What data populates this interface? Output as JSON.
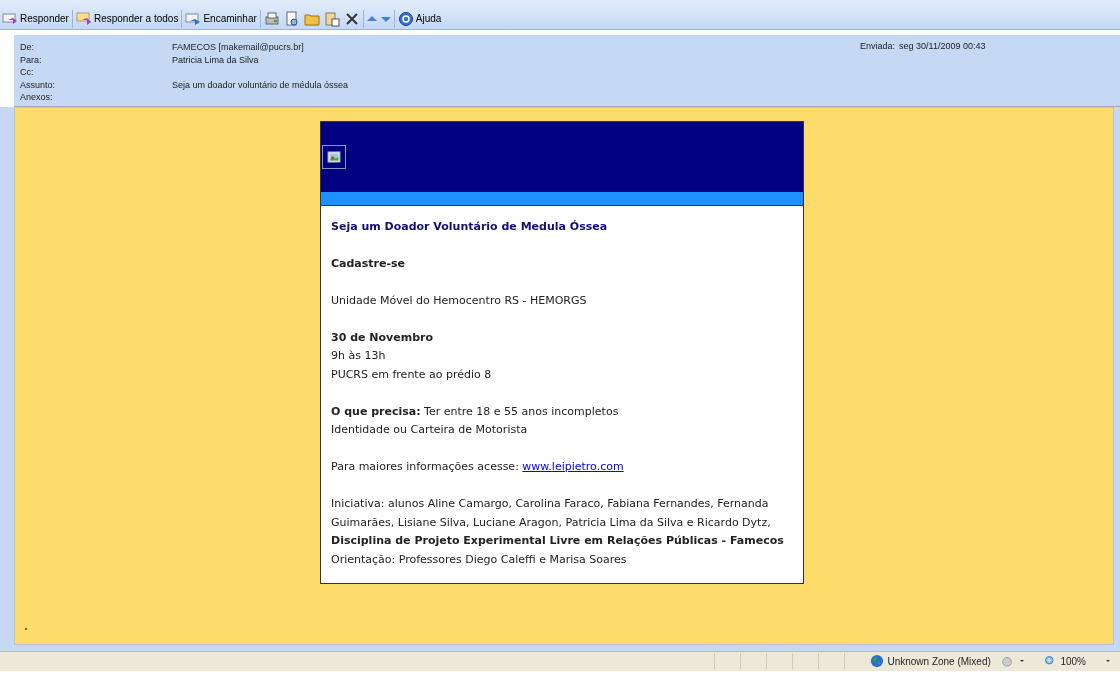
{
  "toolbar": [
    {
      "label": "Responder"
    },
    {
      "label": "Responder a todos"
    },
    {
      "label": "Encaminhar"
    },
    {
      "label": "Ajuda"
    }
  ],
  "header": {
    "fields": [
      {
        "label": "De:",
        "value": "FAMECOS [makemail@pucrs.br]"
      },
      {
        "label": "Para:",
        "value": "Patricia Lima da Silva"
      },
      {
        "label": "Cc:"
      },
      {
        "label": "Assunto:",
        "value": "Seja um doador voluntário de médula óssea"
      },
      {
        "label": "Anexos:"
      }
    ],
    "sent": {
      "label": "Enviada:",
      "value": "seg 30/11/2009 00:43"
    }
  },
  "email": {
    "title": "Seja um Doador Voluntário de Medula Óssea",
    "blocks": [
      {
        "lines": [
          {
            "kind": "bold",
            "text": "Cadastre-se"
          }
        ]
      },
      {
        "lines": [
          {
            "kind": "plain",
            "text": "Unidade Móvel do Hemocentro RS - HEMORGS"
          }
        ]
      },
      {
        "lines": [
          {
            "kind": "bold",
            "text": "30 de Novembro"
          },
          {
            "kind": "plain",
            "text": "9h às 13h"
          },
          {
            "kind": "plain",
            "text": "PUCRS em frente ao prédio 8"
          }
        ]
      },
      {
        "lines": [
          {
            "kind": "rich",
            "text": "**O que precisa:** Ter entre 18 e 55 anos incompletos"
          },
          {
            "kind": "plain",
            "text": "Identidade ou Carteira de Motorista"
          }
        ]
      },
      {
        "lines": [
          {
            "kind": "link",
            "text": "Para maiores informações acesse: ",
            "link": "www.leipietro.com"
          }
        ]
      },
      {
        "lines": [
          {
            "kind": "plain",
            "text": "Iniciativa: alunos Aline Camargo, Carolina Faraco, Fabiana Fernandes, Fernanda Guimarães, Lisiane Silva, Luciane Aragon, Patricia Lima da Silva e Ricardo Dytz,"
          },
          {
            "kind": "bold",
            "text": "Disciplina de Projeto Experimental Livre em Relações Públicas - Famecos"
          },
          {
            "kind": "plain",
            "text": "Orientação: Professores Diego Caleffi e Marisa Soares"
          }
        ]
      }
    ]
  },
  "status_bar": {
    "zone": "Unknown Zone (Mixed)",
    "zoom": "100%"
  }
}
